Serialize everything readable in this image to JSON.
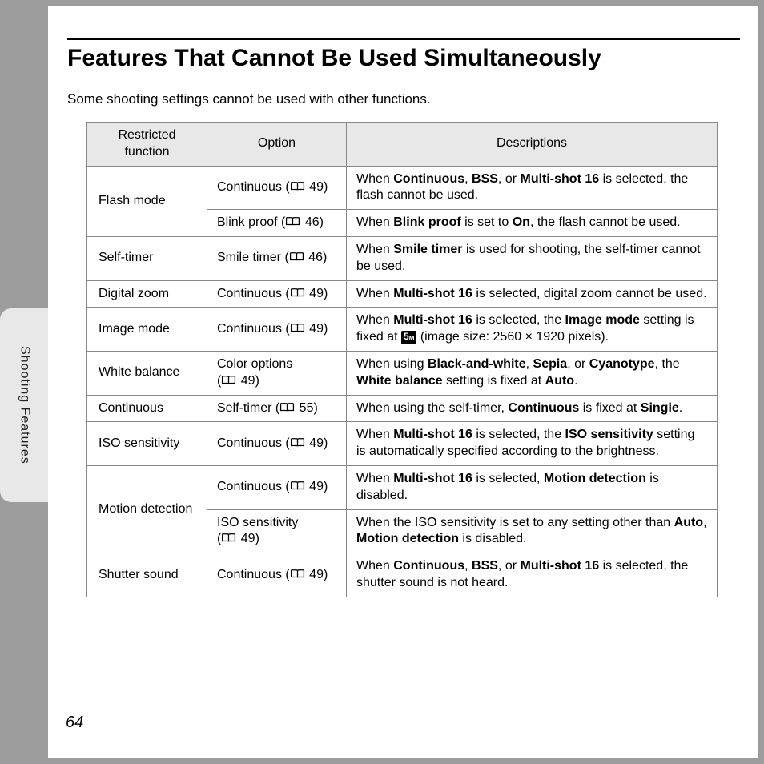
{
  "sideTab": "Shooting Features",
  "title": "Features That Cannot Be Used Simultaneously",
  "intro": "Some shooting settings cannot be used with other functions.",
  "headers": {
    "func": "Restricted function",
    "opt": "Option",
    "desc": "Descriptions"
  },
  "pageNumber": "64",
  "rows": [
    {
      "func": "Flash mode",
      "funcRowspan": 2,
      "opt": {
        "text": "Continuous",
        "ref": "49"
      },
      "desc": [
        {
          "t": "When "
        },
        {
          "b": "Continuous"
        },
        {
          "t": ", "
        },
        {
          "b": "BSS"
        },
        {
          "t": ", or "
        },
        {
          "b": "Multi-shot 16"
        },
        {
          "t": " is selected, the flash cannot be used."
        }
      ]
    },
    {
      "opt": {
        "text": "Blink proof",
        "ref": "46"
      },
      "desc": [
        {
          "t": "When "
        },
        {
          "b": "Blink proof"
        },
        {
          "t": " is set to "
        },
        {
          "b": "On"
        },
        {
          "t": ", the flash cannot be used."
        }
      ]
    },
    {
      "func": "Self-timer",
      "opt": {
        "text": "Smile timer",
        "ref": "46"
      },
      "desc": [
        {
          "t": "When "
        },
        {
          "b": "Smile timer"
        },
        {
          "t": " is used for shooting, the self-timer cannot be used."
        }
      ]
    },
    {
      "func": "Digital zoom",
      "opt": {
        "text": "Continuous",
        "ref": "49"
      },
      "desc": [
        {
          "t": "When "
        },
        {
          "b": "Multi-shot 16"
        },
        {
          "t": " is selected, digital zoom cannot be used."
        }
      ]
    },
    {
      "func": "Image mode",
      "opt": {
        "text": "Continuous",
        "ref": "49"
      },
      "desc": [
        {
          "t": "When "
        },
        {
          "b": "Multi-shot 16"
        },
        {
          "t": " is selected, the "
        },
        {
          "b": "Image mode"
        },
        {
          "t": " setting is fixed at "
        },
        {
          "mode5": true
        },
        {
          "t": " (image size: 2560 × 1920 pixels)."
        }
      ]
    },
    {
      "func": "White balance",
      "opt": {
        "text": "Color options",
        "ref": "49",
        "break": true
      },
      "desc": [
        {
          "t": "When using "
        },
        {
          "b": "Black-and-white"
        },
        {
          "t": ", "
        },
        {
          "b": "Sepia"
        },
        {
          "t": ", or "
        },
        {
          "b": "Cyanotype"
        },
        {
          "t": ", the "
        },
        {
          "b": "White balance"
        },
        {
          "t": " setting is fixed at "
        },
        {
          "b": "Auto"
        },
        {
          "t": "."
        }
      ]
    },
    {
      "func": "Continuous",
      "opt": {
        "text": "Self-timer",
        "ref": "55"
      },
      "desc": [
        {
          "t": "When using the self-timer, "
        },
        {
          "b": "Continuous"
        },
        {
          "t": " is fixed at "
        },
        {
          "b": "Single"
        },
        {
          "t": "."
        }
      ]
    },
    {
      "func": "ISO sensitivity",
      "opt": {
        "text": "Continuous",
        "ref": "49"
      },
      "desc": [
        {
          "t": "When "
        },
        {
          "b": "Multi-shot 16"
        },
        {
          "t": " is selected, the "
        },
        {
          "b": "ISO sensitivity"
        },
        {
          "t": " setting is automatically specified according to the brightness."
        }
      ]
    },
    {
      "func": "Motion detection",
      "funcRowspan": 2,
      "opt": {
        "text": "Continuous",
        "ref": "49"
      },
      "desc": [
        {
          "t": "When "
        },
        {
          "b": "Multi-shot 16"
        },
        {
          "t": " is selected, "
        },
        {
          "b": "Motion detection"
        },
        {
          "t": " is disabled."
        }
      ]
    },
    {
      "opt": {
        "text": "ISO sensitivity",
        "ref": "49",
        "break": true
      },
      "desc": [
        {
          "t": "When the ISO sensitivity is set to any setting other than "
        },
        {
          "b": "Auto"
        },
        {
          "t": ", "
        },
        {
          "b": "Motion detection"
        },
        {
          "t": " is disabled."
        }
      ]
    },
    {
      "func": "Shutter sound",
      "opt": {
        "text": "Continuous",
        "ref": "49"
      },
      "desc": [
        {
          "t": "When "
        },
        {
          "b": "Continuous"
        },
        {
          "t": ", "
        },
        {
          "b": "BSS"
        },
        {
          "t": ", or "
        },
        {
          "b": "Multi-shot 16"
        },
        {
          "t": " is selected, the shutter sound is not heard."
        }
      ]
    }
  ]
}
